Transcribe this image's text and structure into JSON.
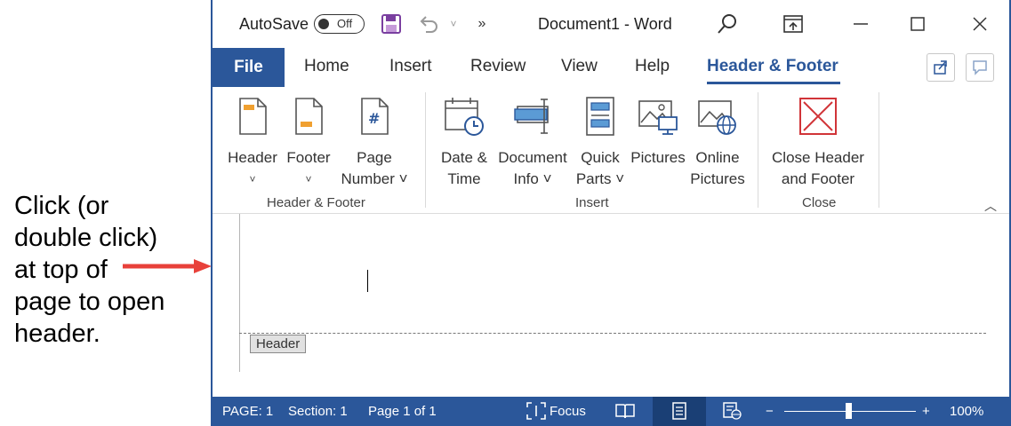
{
  "annotation": {
    "lines": [
      "Click (or",
      "double click)",
      "at top of",
      "page to open",
      "header."
    ],
    "arrow_color": "#e8413a"
  },
  "titlebar": {
    "autosave_label": "AutoSave",
    "autosave_state": "Off",
    "document_title": "Document1  -  Word",
    "icons": [
      "save-icon",
      "undo-icon",
      "chevron-down-icon",
      "more-commands-icon",
      "search-icon",
      "ribbon-display-icon",
      "minimize-icon",
      "maximize-icon",
      "close-icon"
    ]
  },
  "tabs": {
    "file": "File",
    "items": [
      "Home",
      "Insert",
      "Review",
      "View",
      "Help",
      "Header & Footer"
    ],
    "active": "Header & Footer"
  },
  "ribbon": {
    "groups": [
      {
        "label": "Header & Footer",
        "buttons": [
          {
            "line1": "Header",
            "line2": "˅",
            "icon": "header-icon"
          },
          {
            "line1": "Footer",
            "line2": "˅",
            "icon": "footer-icon"
          },
          {
            "line1": "Page",
            "line2": "Number ˅",
            "icon": "page-number-icon"
          }
        ]
      },
      {
        "label": "Insert",
        "buttons": [
          {
            "line1": "Date &",
            "line2": "Time",
            "icon": "date-time-icon"
          },
          {
            "line1": "Document",
            "line2": "Info ˅",
            "icon": "document-info-icon"
          },
          {
            "line1": "Quick",
            "line2": "Parts ˅",
            "icon": "quick-parts-icon"
          },
          {
            "line1": "Pictures",
            "line2": "",
            "icon": "pictures-icon"
          },
          {
            "line1": "Online",
            "line2": "Pictures",
            "icon": "online-pictures-icon"
          }
        ]
      },
      {
        "label": "Close",
        "buttons": [
          {
            "line1": "Close Header",
            "line2": "and Footer",
            "icon": "close-header-footer-icon"
          }
        ]
      }
    ]
  },
  "document": {
    "header_tag": "Header"
  },
  "statusbar": {
    "page": "PAGE: 1",
    "section": "Section: 1",
    "page_of": "Page 1 of 1",
    "focus": "Focus",
    "zoom": "100%",
    "zoom_minus": "−",
    "zoom_plus": "+"
  },
  "colors": {
    "accent": "#2b579a",
    "close_icon_red": "#d13438"
  }
}
